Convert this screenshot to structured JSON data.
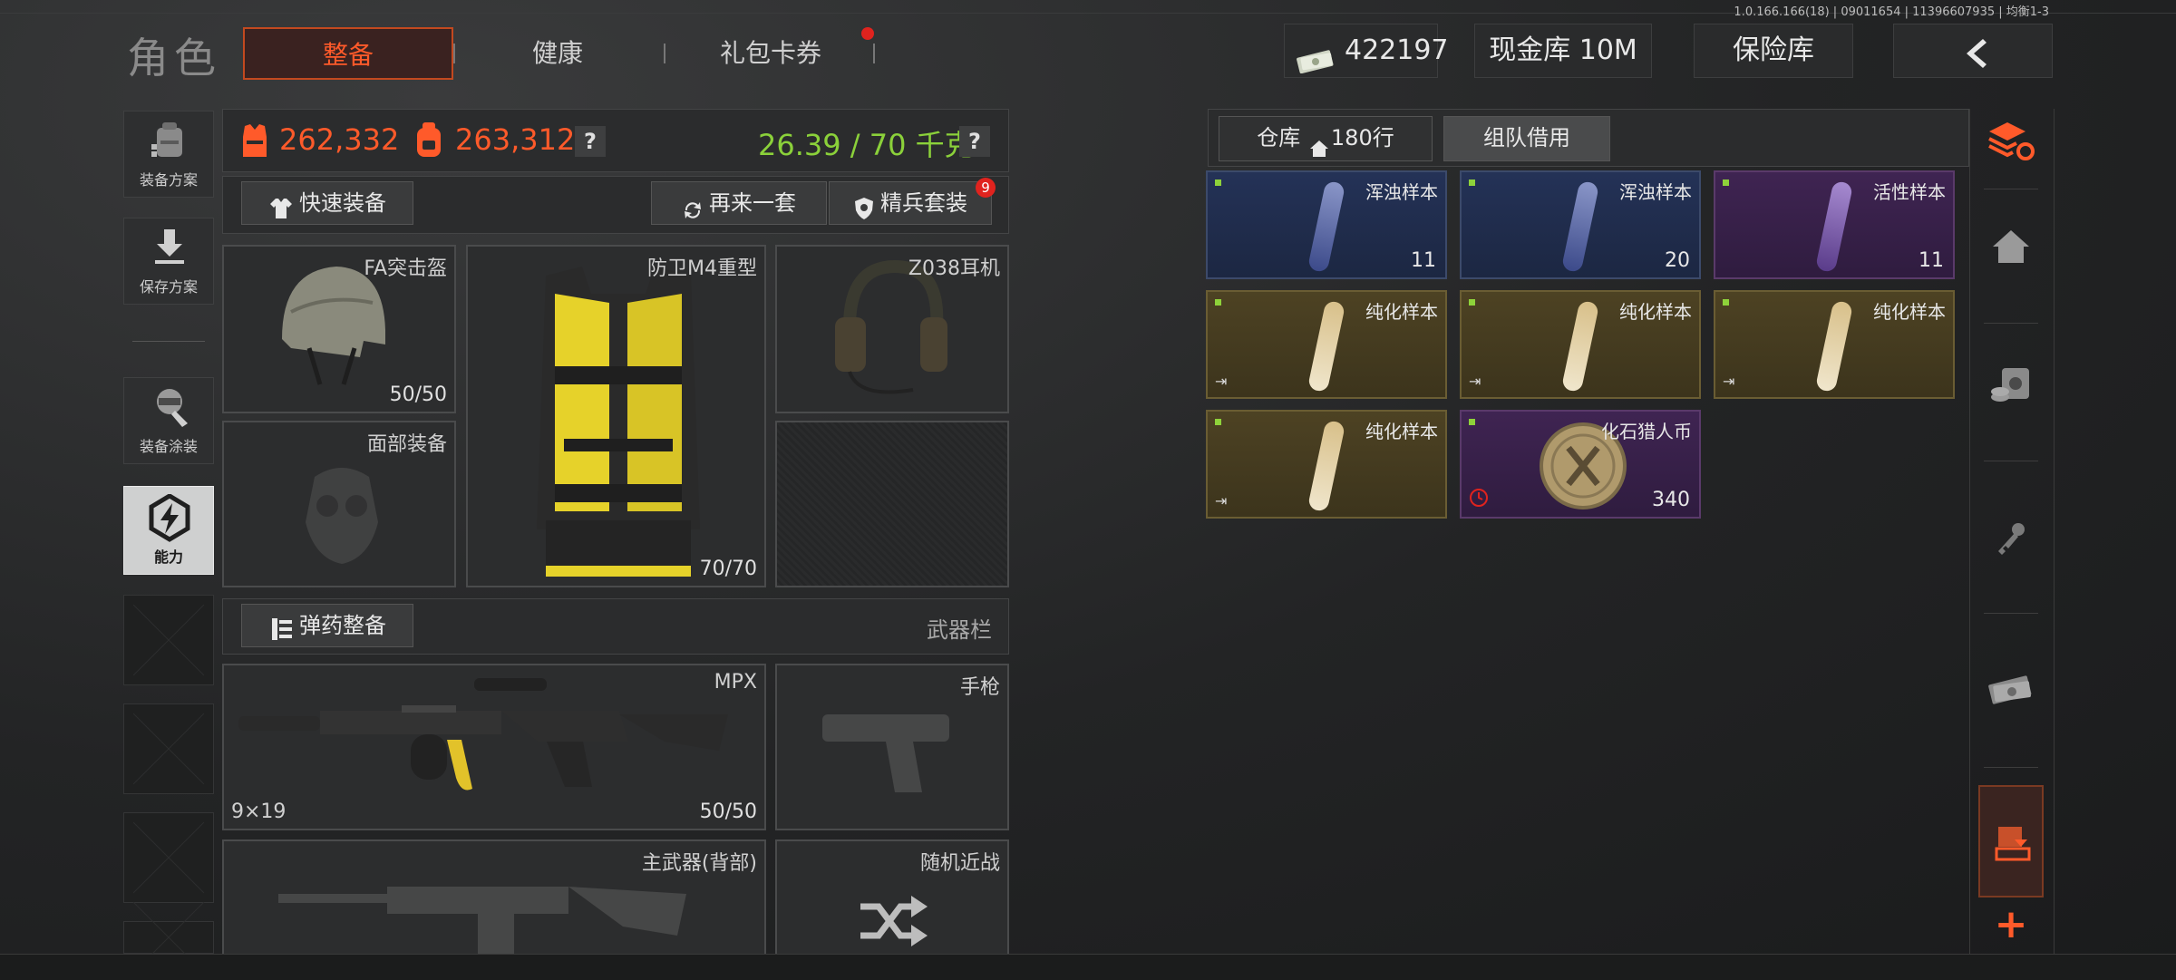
{
  "version_info": "1.0.166.166(18) | 09011654 | 11396607935 | 均衡1-3",
  "header": {
    "title": "角色",
    "tabs": [
      {
        "label": "整备",
        "active": true
      },
      {
        "label": "健康",
        "active": false
      },
      {
        "label": "礼包卡券",
        "active": false,
        "has_notification": true
      }
    ],
    "currency": "422197",
    "cash_vault": "现金库 10M",
    "safe_box": "保险库",
    "back_icon": "chevron-left-icon"
  },
  "left_sidebar": {
    "buttons": [
      {
        "label": "装备方案",
        "icon": "backpack-icon"
      },
      {
        "label": "保存方案",
        "icon": "download-icon"
      },
      {
        "label": "装备涂装",
        "icon": "paint-icon"
      },
      {
        "label": "能力",
        "icon": "lightning-gear-icon",
        "active": true
      }
    ]
  },
  "stats": {
    "armor_value": "262,332",
    "bag_value": "263,312",
    "weight": "26.39 / 70 千克",
    "colors": {
      "value": "#ff5a2a",
      "weight": "#8bd13a"
    }
  },
  "gear_actions": {
    "quick_equip": "快速装备",
    "repeat_set": "再来一套",
    "elite_set": "精兵套装",
    "elite_badge": "9"
  },
  "gear_slots": {
    "helmet": {
      "name": "FA突击盔",
      "durability": "50/50"
    },
    "vest": {
      "name": "防卫M4重型",
      "durability": "70/70"
    },
    "headset": {
      "name": "Z038耳机"
    },
    "face": {
      "name": "面部装备"
    }
  },
  "weapons": {
    "ammo_button": "弹药整备",
    "section_label": "武器栏",
    "primary": {
      "name": "MPX",
      "caliber": "9×19",
      "ammo": "50/50"
    },
    "pistol": {
      "name": "手枪"
    },
    "primary_back": {
      "name": "主武器(背部)"
    },
    "melee": {
      "name": "随机近战"
    }
  },
  "warehouse": {
    "tab_storage": "仓库",
    "storage_rows": "180行",
    "tab_team": "组队借用",
    "items": [
      {
        "name": "浑浊样本",
        "count": "11",
        "rarity": "blue"
      },
      {
        "name": "浑浊样本",
        "count": "20",
        "rarity": "blue"
      },
      {
        "name": "活性样本",
        "count": "11",
        "rarity": "purple"
      },
      {
        "name": "纯化样本",
        "count": "",
        "rarity": "gold"
      },
      {
        "name": "纯化样本",
        "count": "",
        "rarity": "gold"
      },
      {
        "name": "纯化样本",
        "count": "",
        "rarity": "gold"
      },
      {
        "name": "纯化样本",
        "count": "",
        "rarity": "gold"
      },
      {
        "name": "化石猎人币",
        "count": "340",
        "rarity": "purple"
      }
    ]
  },
  "right_toolbar": {
    "icons": [
      "sort-refresh-icon",
      "home-icon",
      "safe-icon",
      "key-icon",
      "cash-icon",
      "box-download-icon",
      "plus-icon"
    ]
  }
}
